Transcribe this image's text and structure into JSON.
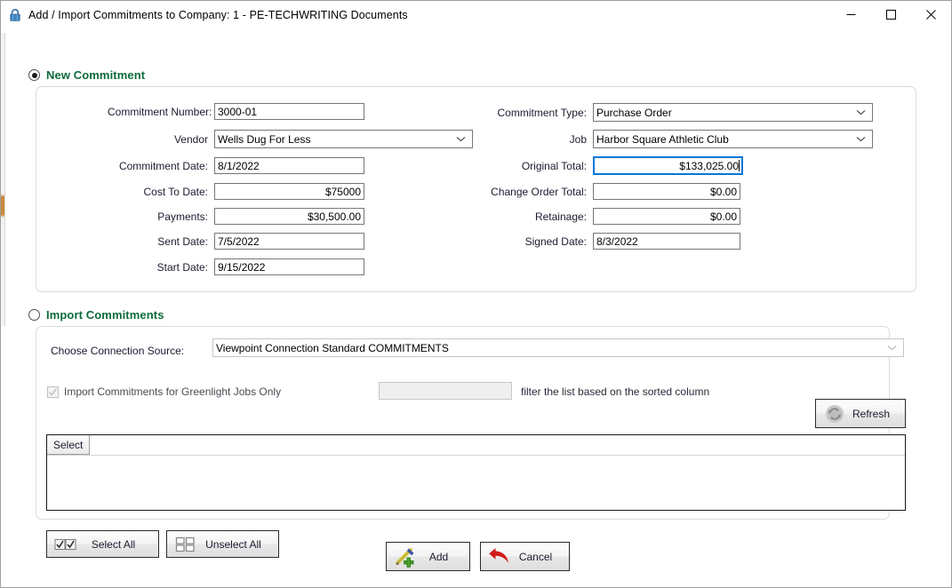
{
  "window": {
    "title": "Add / Import Commitments to Company: 1 - PE-TECHWRITING Documents",
    "lock_icon": "lock-icon",
    "minimize_label": "Minimize",
    "maximize_label": "Maximize",
    "close_label": "Close"
  },
  "new_commitment": {
    "section_label": "New Commitment",
    "selected": true,
    "left_fields": [
      {
        "label": "Commitment Number:",
        "value": "3000-01",
        "type": "text",
        "align": "left"
      },
      {
        "label": "Vendor",
        "value": "Wells Dug For Less",
        "type": "combo",
        "align": "left"
      },
      {
        "label": "Commitment Date:",
        "value": "8/1/2022",
        "type": "text",
        "align": "left"
      },
      {
        "label": "Cost To Date:",
        "value": "$75000",
        "type": "text",
        "align": "right"
      },
      {
        "label": "Payments:",
        "value": "$30,500.00",
        "type": "text",
        "align": "right"
      },
      {
        "label": "Sent Date:",
        "value": "7/5/2022",
        "type": "text",
        "align": "left"
      },
      {
        "label": "Start Date:",
        "value": "9/15/2022",
        "type": "text",
        "align": "left"
      }
    ],
    "right_fields": [
      {
        "label": "Commitment Type:",
        "value": "Purchase Order",
        "type": "combo",
        "align": "left"
      },
      {
        "label": "Job",
        "value": "Harbor Square Athletic Club",
        "type": "combo",
        "align": "left"
      },
      {
        "label": "Original Total:",
        "value": "$133,025.00",
        "type": "text",
        "align": "right",
        "focused": true
      },
      {
        "label": "Change Order Total:",
        "value": "$0.00",
        "type": "text",
        "align": "right"
      },
      {
        "label": "Retainage:",
        "value": "$0.00",
        "type": "text",
        "align": "right"
      },
      {
        "label": "Signed Date:",
        "value": "8/3/2022",
        "type": "text",
        "align": "left"
      }
    ]
  },
  "import_commitments": {
    "section_label": "Import Commitments",
    "selected": false,
    "connection_source_label": "Choose Connection Source:",
    "connection_source_value": "Viewpoint Connection Standard COMMITMENTS",
    "greenlight_checkbox_label": "Import Commitments for Greenlight Jobs Only",
    "greenlight_checked": true,
    "filter_value": "",
    "filter_hint": "filter the list based on the sorted column",
    "refresh_label": "Refresh",
    "refresh_icon": "refresh-icon",
    "grid": {
      "columns": [
        "Select"
      ],
      "rows": []
    }
  },
  "footer": {
    "select_all_label": "Select All",
    "select_all_icon": "checked-boxes-icon",
    "unselect_all_label": "Unselect All",
    "unselect_all_icon": "empty-boxes-icon",
    "add_label": "Add",
    "add_icon": "pen-plus-icon",
    "cancel_label": "Cancel",
    "cancel_icon": "red-arrow-icon"
  },
  "colors": {
    "section_green": "#0b6b3a",
    "focus_blue": "#0078d7",
    "cancel_red": "#d01a1a",
    "add_green": "#4aa02c"
  }
}
